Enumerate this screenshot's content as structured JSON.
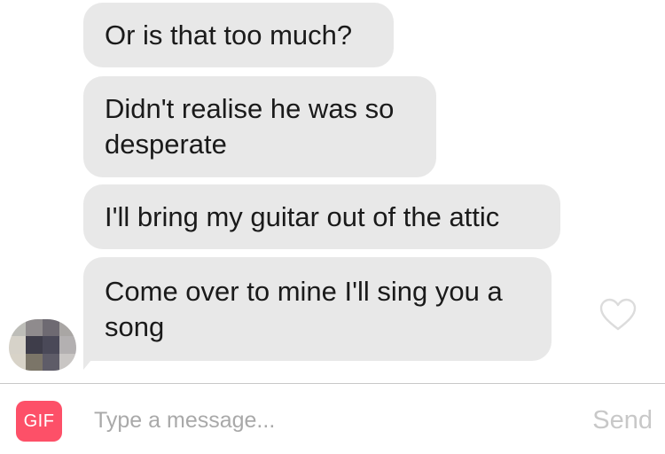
{
  "messages": [
    {
      "text": "Or is that too much?"
    },
    {
      "text": "Didn't realise he was so desperate"
    },
    {
      "text": "I'll bring my guitar out of the attic"
    },
    {
      "text": "Come over to mine I'll sing you a song"
    }
  ],
  "composer": {
    "gif_label": "GIF",
    "placeholder": "Type a message...",
    "send_label": "Send"
  },
  "colors": {
    "bubble": "#e8e8e8",
    "gif_button": "#fd5068",
    "send_disabled": "#c8c8c8",
    "heart_outline": "#dcdcdc"
  },
  "icons": {
    "like": "heart-outline-icon",
    "sender_avatar": "pixelated-avatar"
  }
}
